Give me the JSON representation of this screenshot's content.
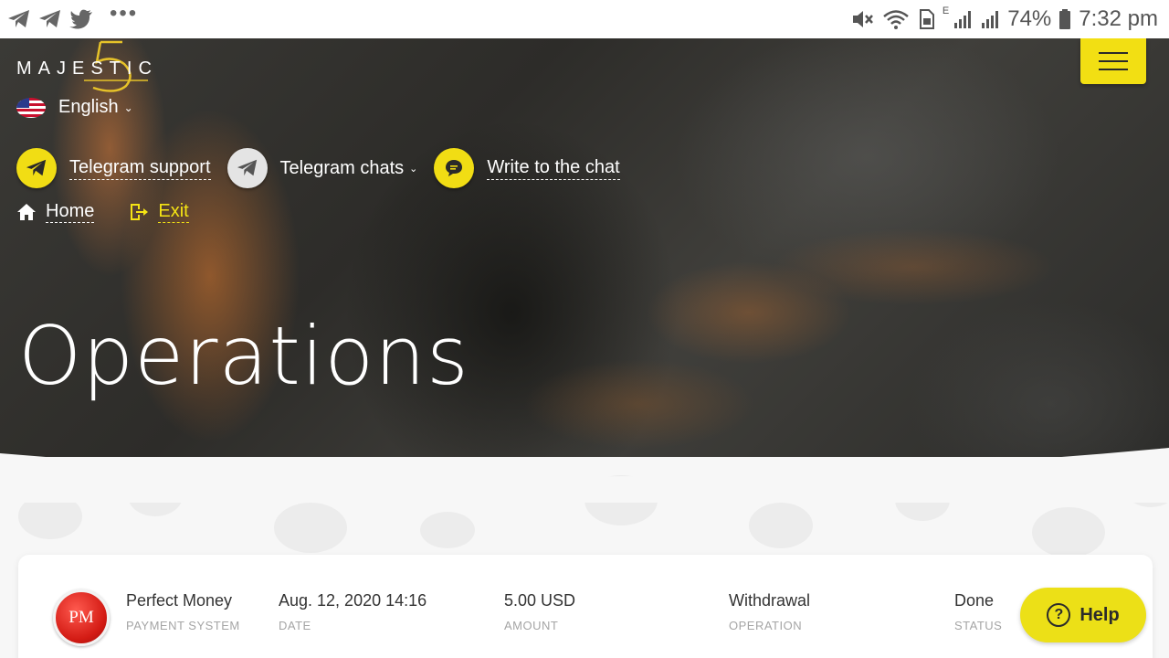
{
  "statusbar": {
    "battery": "74%",
    "time": "7:32 pm",
    "network_letter": "E",
    "dots": "•••"
  },
  "header": {
    "logo_text": "MAJESTIC",
    "language": "English",
    "contacts": [
      {
        "label": "Telegram support"
      },
      {
        "label": "Telegram chats"
      },
      {
        "label": "Write to the chat"
      }
    ],
    "nav": {
      "home": "Home",
      "exit": "Exit"
    }
  },
  "page": {
    "title": "Operations"
  },
  "operation": {
    "logo_text": "PM",
    "payment_system": "Perfect Money",
    "payment_system_label": "PAYMENT SYSTEM",
    "date": "Aug. 12, 2020 14:16",
    "date_label": "DATE",
    "amount": "5.00 USD",
    "amount_label": "AMOUNT",
    "operation": "Withdrawal",
    "operation_label": "OPERATION",
    "status": "Done",
    "status_label": "STATUS"
  },
  "help": {
    "label": "Help",
    "symbol": "?"
  },
  "colors": {
    "accent_yellow": "#f2df13",
    "exit_yellow": "#f5e414",
    "pm_red": "#d31b14"
  }
}
